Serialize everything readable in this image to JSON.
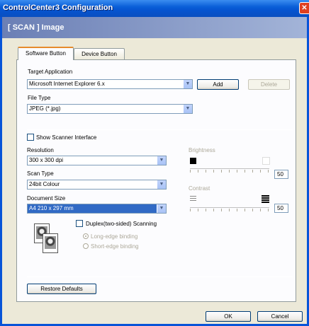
{
  "window": {
    "title": "ControlCenter3 Configuration",
    "close_label": "✕",
    "header": "[ SCAN ]  Image"
  },
  "tabs": [
    {
      "label": "Software Button",
      "active": true
    },
    {
      "label": "Device Button",
      "active": false
    }
  ],
  "target_application": {
    "label": "Target Application",
    "value": "Microsoft Internet Explorer 6.x",
    "add_label": "Add",
    "delete_label": "Delete"
  },
  "file_type": {
    "label": "File Type",
    "value": "JPEG (*.jpg)"
  },
  "show_scanner_interface": {
    "label": "Show Scanner Interface",
    "checked": false
  },
  "resolution": {
    "label": "Resolution",
    "value": "300 x 300 dpi"
  },
  "scan_type": {
    "label": "Scan Type",
    "value": "24bit Colour"
  },
  "document_size": {
    "label": "Document Size",
    "value": "A4 210 x 297 mm"
  },
  "duplex": {
    "label": "Duplex(two-sided) Scanning",
    "checked": false,
    "options": [
      {
        "label": "Long-edge binding",
        "selected": true
      },
      {
        "label": "Short-edge binding",
        "selected": false
      }
    ]
  },
  "brightness": {
    "label": "Brightness",
    "value": "50"
  },
  "contrast": {
    "label": "Contrast",
    "value": "50"
  },
  "restore_label": "Restore Defaults",
  "ok_label": "OK",
  "cancel_label": "Cancel",
  "icon_names": {
    "dropdown": "chevron-down-icon",
    "document_preview": "document-icon"
  }
}
